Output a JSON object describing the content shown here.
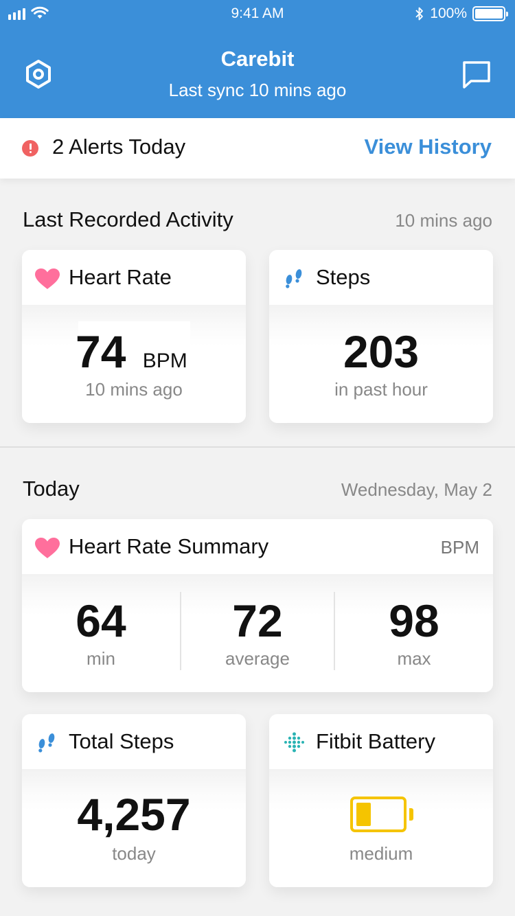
{
  "status_bar": {
    "time": "9:41 AM",
    "battery": "100%"
  },
  "header": {
    "title": "Carebit",
    "subtitle": "Last sync 10 mins ago"
  },
  "alerts": {
    "text": "2 Alerts Today",
    "link": "View History"
  },
  "last_activity": {
    "title": "Last Recorded Activity",
    "time_ago": "10 mins ago",
    "heart_rate": {
      "title": "Heart Rate",
      "value": "74",
      "unit": "BPM",
      "caption": "10 mins ago"
    },
    "steps": {
      "title": "Steps",
      "value": "203",
      "caption": "in past hour"
    }
  },
  "today": {
    "title": "Today",
    "date": "Wednesday, May 2",
    "hr_summary": {
      "title": "Heart Rate Summary",
      "unit": "BPM",
      "stats": [
        {
          "value": "64",
          "label": "min"
        },
        {
          "value": "72",
          "label": "average"
        },
        {
          "value": "98",
          "label": "max"
        }
      ]
    },
    "total_steps": {
      "title": "Total Steps",
      "value": "4,257",
      "caption": "today"
    },
    "battery": {
      "title": "Fitbit Battery",
      "level": 0.33,
      "caption": "medium"
    }
  },
  "colors": {
    "header": "#3b8fd9",
    "accent": "#3b8fd9",
    "heart": "#ff6f9c",
    "alert": "#f06262",
    "fitbit": "#2ab3b3",
    "battery": "#f5c400"
  }
}
